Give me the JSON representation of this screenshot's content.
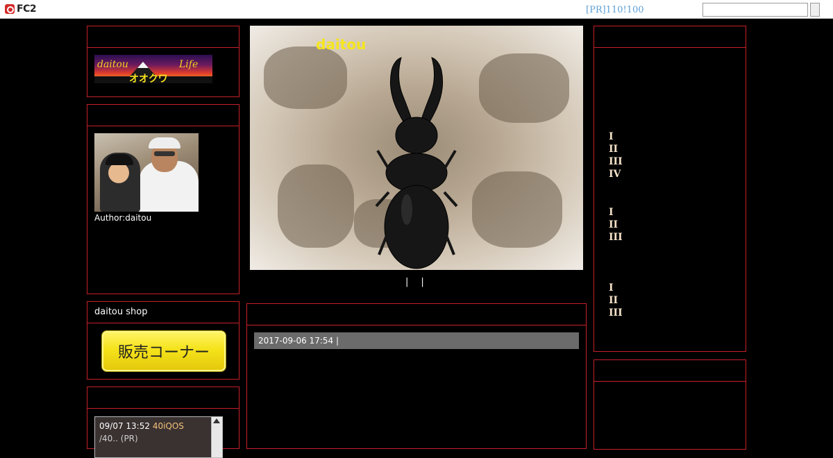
{
  "topbar": {
    "brand": "FC2",
    "pr_link": "[PR]110!100",
    "search_placeholder": ""
  },
  "left": {
    "logo": {
      "left_text": "daitou",
      "right_text": "Life",
      "center_text": "オオクワ"
    },
    "profile": {
      "author": "Author:daitou"
    },
    "shop": {
      "title": "daitou  shop",
      "button_label": "販売コーナー"
    },
    "recent": {
      "entry_time": "09/07 13:52",
      "entry_link": "40iQOS",
      "entry_more": "/40.. (PR)"
    }
  },
  "center": {
    "blog_name": "daitou",
    "nav_sep": [
      "|",
      "|"
    ],
    "post_meta": "2017-09-06 17:54 |"
  },
  "right": {
    "group1": [
      "I",
      "II",
      "III",
      "IV"
    ],
    "group2": [
      "I",
      "II",
      "III"
    ],
    "group3": [
      "I",
      "II",
      "III"
    ]
  },
  "colors": {
    "panel_border": "#c8202a",
    "blog_name": "#f5e61e",
    "date_bar": "#6b6b6b"
  }
}
